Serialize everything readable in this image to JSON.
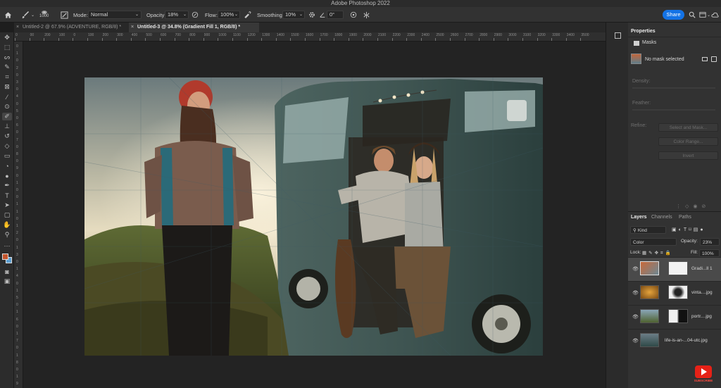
{
  "app": {
    "title": "Adobe Photoshop 2022"
  },
  "options": {
    "brush_size": "1000",
    "mode_label": "Mode:",
    "mode_value": "Normal",
    "opacity_label": "Opacity:",
    "opacity_value": "18%",
    "flow_label": "Flow:",
    "flow_value": "100%",
    "smoothing_label": "Smoothing:",
    "smoothing_value": "10%",
    "angle_value": "0°",
    "share_label": "Share"
  },
  "tabs": [
    {
      "label": "Untitled-2 @ 67.9% (ADVENTURE, RGB/8) *",
      "active": false
    },
    {
      "label": "Untitled-3 @ 34.8% (Gradient Fill 1, RGB/8) *",
      "active": true
    }
  ],
  "ruler": {
    "top": [
      "0",
      "00",
      "200",
      "100",
      "0",
      "100",
      "200",
      "300",
      "400",
      "500",
      "600",
      "700",
      "800",
      "900",
      "1000",
      "1100",
      "1200",
      "1300",
      "1400",
      "1500",
      "1600",
      "1700",
      "1800",
      "1900",
      "2000",
      "2100",
      "2200",
      "2300",
      "2400",
      "2500",
      "2600",
      "2700",
      "2800",
      "2900",
      "3000",
      "3100",
      "3200",
      "3300",
      "3400",
      "3500"
    ],
    "left": [
      "0",
      "1",
      "0",
      "2",
      "0",
      "3",
      "0",
      "4",
      "0",
      "5",
      "0",
      "6",
      "0",
      "7",
      "0",
      "8",
      "0",
      "9",
      "0",
      "1",
      "0",
      "0",
      "1",
      "1",
      "0",
      "1",
      "2",
      "0",
      "1",
      "3",
      "0",
      "1",
      "4",
      "0",
      "1",
      "5",
      "0",
      "1",
      "6",
      "0",
      "1",
      "7",
      "0",
      "1",
      "8",
      "0",
      "1",
      "9"
    ]
  },
  "properties": {
    "tab": "Properties",
    "masks_label": "Masks",
    "mask_status": "No mask selected",
    "density_label": "Density:",
    "feather_label": "Feather:",
    "refine_label": "Refine:",
    "select_mask_btn": "Select and Mask...",
    "color_range_btn": "Color Range...",
    "invert_btn": "Invert"
  },
  "layers_panel": {
    "tabs": [
      "Layers",
      "Channels",
      "Paths"
    ],
    "kind_label": "Kind",
    "blend_mode": "Color",
    "opacity_label": "Opacity:",
    "opacity_value": "23%",
    "lock_label": "Lock:",
    "fill_label": "Fill:",
    "fill_value": "100%",
    "layers": [
      {
        "name": "Gradi...ll 1",
        "selected": true
      },
      {
        "name": "vinta....jpg",
        "selected": false
      },
      {
        "name": "portr....jpg",
        "selected": false
      },
      {
        "name": "life-is-an-...04-utc.jpg",
        "selected": false
      }
    ]
  },
  "badge": {
    "label": "SUBSCRIBE"
  },
  "colors": {
    "accent": "#1473e6",
    "foreground_swatch": "#c4562e",
    "background_swatch": "#5b9fd1",
    "youtube_red": "#e62117"
  }
}
